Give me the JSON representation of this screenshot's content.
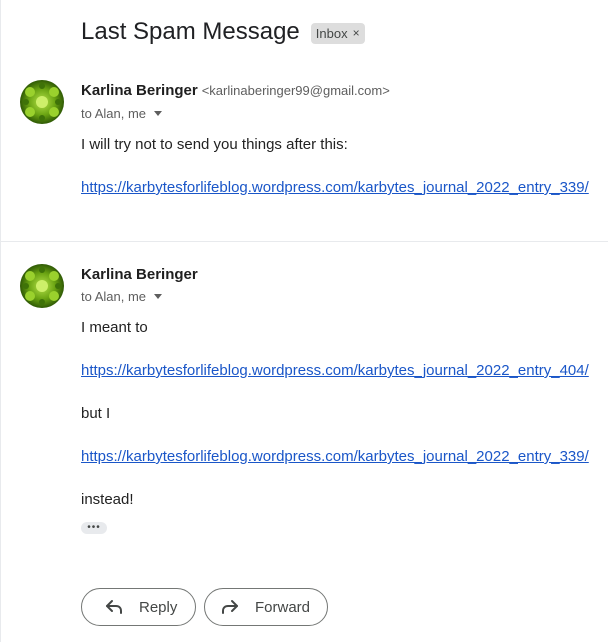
{
  "thread": {
    "subject": "Last Spam Message",
    "label": "Inbox",
    "label_remove": "×"
  },
  "messages": [
    {
      "sender_name": "Karlina Beringer",
      "sender_email": "<karlinaberinger99@gmail.com>",
      "recipients": "to Alan, me",
      "lines": [
        "I will try not to send you things after this:",
        "https://karbytesforlifeblog.wordpress.com/karbytes_journal_2022_entry_339/"
      ]
    },
    {
      "sender_name": "Karlina Beringer",
      "recipients": "to Alan, me",
      "lines": [
        "I meant to",
        "https://karbytesforlifeblog.wordpress.com/karbytes_journal_2022_entry_404/",
        "but I",
        "https://karbytesforlifeblog.wordpress.com/karbytes_journal_2022_entry_339/",
        "instead!"
      ],
      "show_trimmed": "•••"
    }
  ],
  "actions": {
    "reply": "Reply",
    "forward": "Forward"
  },
  "colors": {
    "link": "#1a56c8",
    "chip_bg": "#dddddd",
    "avatar_green": "#6aa312"
  },
  "icons": [
    "dropdown-caret-icon",
    "reply-arrow-icon",
    "forward-arrow-icon",
    "more-dots-icon"
  ]
}
